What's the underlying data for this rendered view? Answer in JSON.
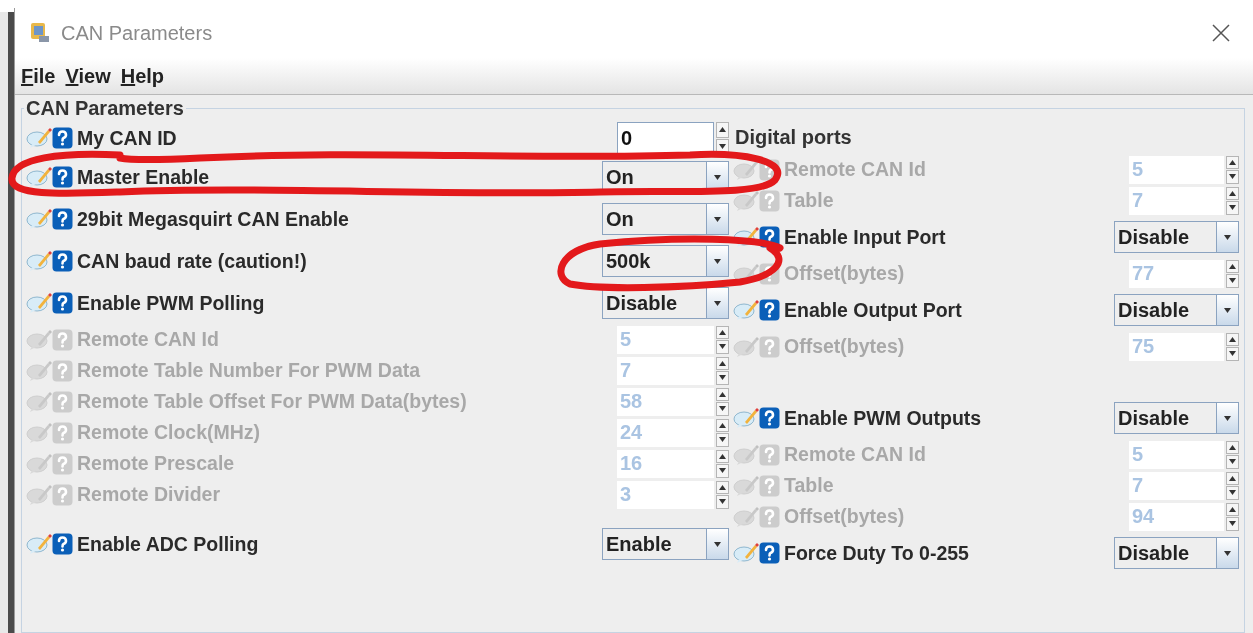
{
  "window": {
    "title": "CAN Parameters"
  },
  "menu": [
    {
      "label": "File"
    },
    {
      "label": "View"
    },
    {
      "label": "Help"
    }
  ],
  "panel": {
    "title": "CAN Parameters",
    "left_groups": [
      {
        "rows": [
          {
            "label": "My CAN ID",
            "kind": "spinner",
            "value": "0",
            "enabled": true
          },
          {
            "label": "Master Enable",
            "kind": "combo",
            "value": "On",
            "enabled": true
          },
          {
            "label": "29bit Megasquirt CAN Enable",
            "kind": "combo",
            "value": "On",
            "enabled": true
          },
          {
            "label": "CAN baud rate (caution!)",
            "kind": "combo",
            "value": "500k",
            "enabled": true
          },
          {
            "label": "Enable PWM Polling",
            "kind": "combo",
            "value": "Disable",
            "enabled": true
          },
          {
            "label": "Remote CAN Id",
            "kind": "spinner",
            "value": "5",
            "enabled": false
          },
          {
            "label": "Remote Table Number For PWM Data",
            "kind": "spinner",
            "value": "7",
            "enabled": false
          },
          {
            "label": "Remote Table Offset For PWM Data(bytes)",
            "kind": "spinner",
            "value": "58",
            "enabled": false
          },
          {
            "label": "Remote Clock(MHz)",
            "kind": "spinner",
            "value": "24",
            "enabled": false
          },
          {
            "label": "Remote Prescale",
            "kind": "spinner",
            "value": "16",
            "enabled": false
          },
          {
            "label": "Remote Divider",
            "kind": "spinner",
            "value": "3",
            "enabled": false
          }
        ]
      },
      {
        "rows": [
          {
            "label": "Enable ADC Polling",
            "kind": "combo",
            "value": "Enable",
            "enabled": true
          }
        ]
      }
    ],
    "digital_ports": {
      "title": "Digital ports",
      "groups": [
        {
          "rows": [
            {
              "label": "Remote CAN Id",
              "kind": "spinner",
              "value": "5",
              "enabled": false
            },
            {
              "label": "Table",
              "kind": "spinner",
              "value": "7",
              "enabled": false
            },
            {
              "label": "Enable Input Port",
              "kind": "combo",
              "value": "Disable",
              "enabled": true
            },
            {
              "label": "Offset(bytes)",
              "kind": "spinner",
              "value": "77",
              "enabled": false
            },
            {
              "label": "Enable Output Port",
              "kind": "combo",
              "value": "Disable",
              "enabled": true
            },
            {
              "label": "Offset(bytes)",
              "kind": "spinner",
              "value": "75",
              "enabled": false
            }
          ]
        },
        {
          "rows": [
            {
              "label": "Enable PWM Outputs",
              "kind": "combo",
              "value": "Disable",
              "enabled": true
            },
            {
              "label": "Remote CAN Id",
              "kind": "spinner",
              "value": "5",
              "enabled": false
            },
            {
              "label": "Table",
              "kind": "spinner",
              "value": "7",
              "enabled": false
            },
            {
              "label": "Offset(bytes)",
              "kind": "spinner",
              "value": "94",
              "enabled": false
            },
            {
              "label": "Force Duty To 0-255",
              "kind": "combo",
              "value": "Disable",
              "enabled": true
            }
          ]
        }
      ]
    }
  }
}
